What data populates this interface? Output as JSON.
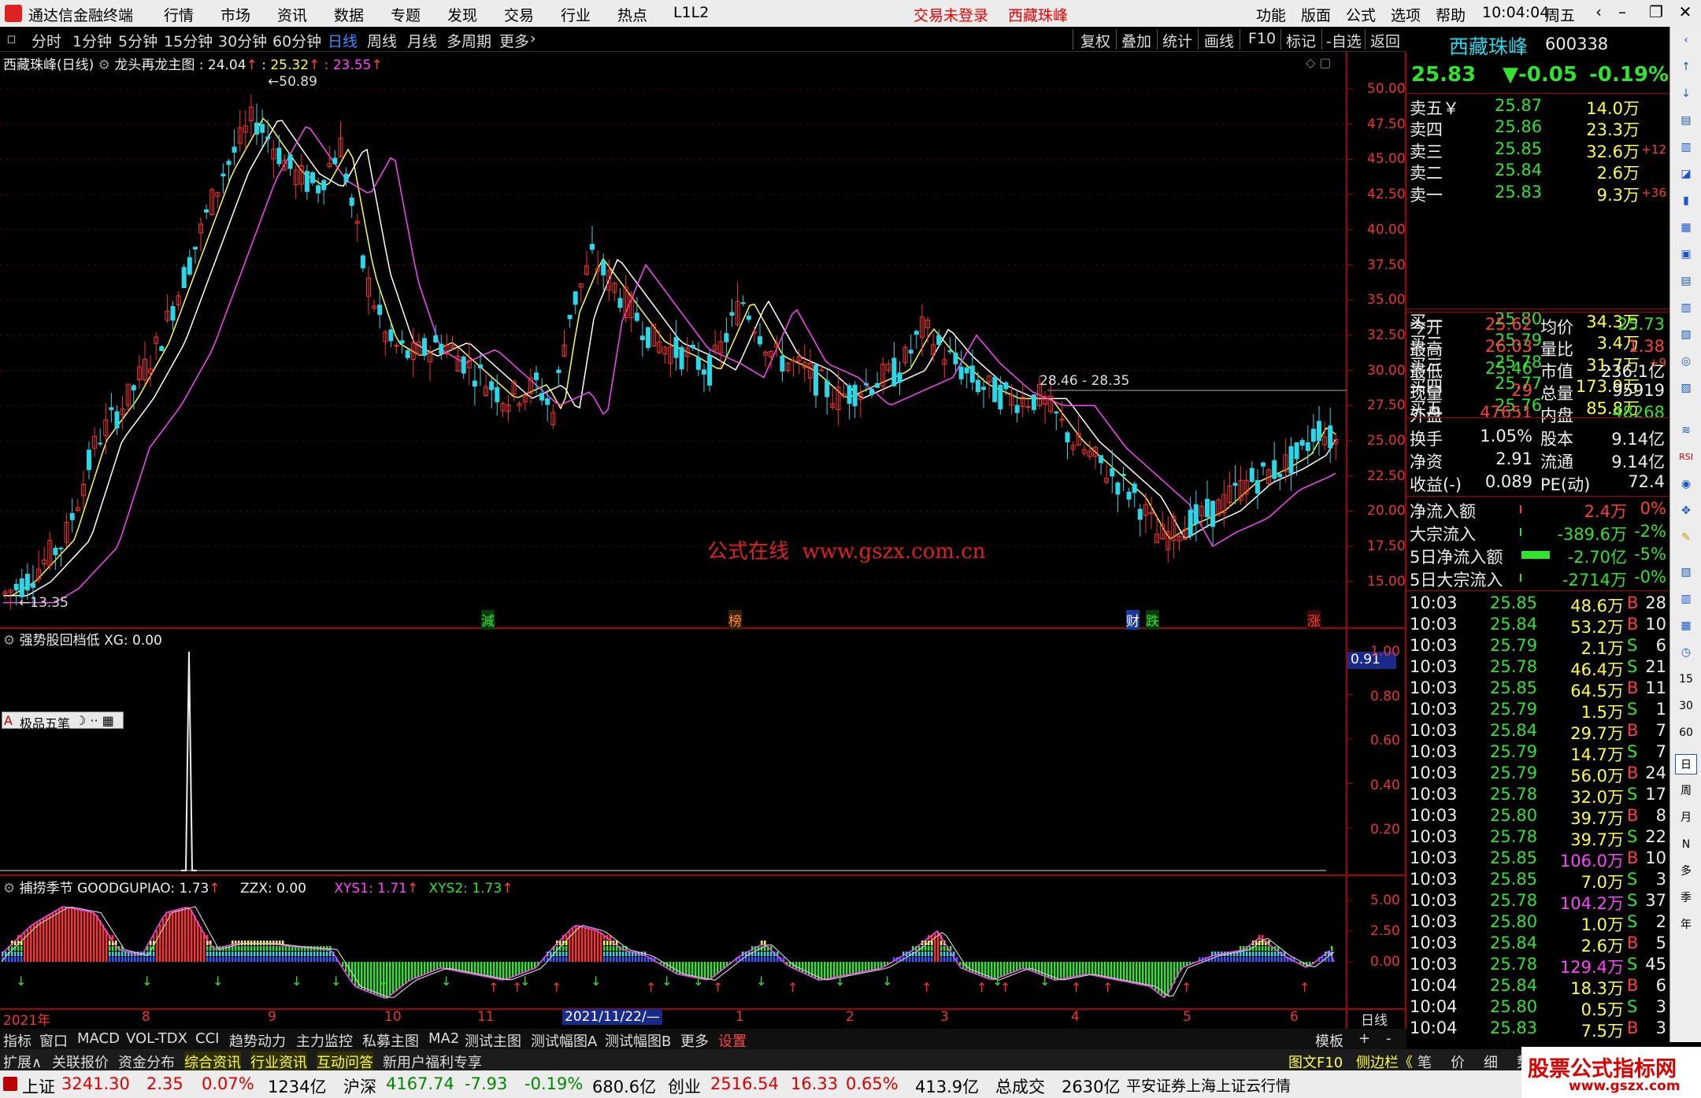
{
  "menubar": {
    "app_title": "通达信金融终端",
    "menus": [
      "行情",
      "市场",
      "资讯",
      "数据",
      "专题",
      "发现",
      "交易",
      "行业",
      "热点",
      "L1L2"
    ],
    "status": "交易未登录",
    "stock": "西藏珠峰",
    "right_menus": [
      "功能",
      "版面",
      "公式",
      "选项",
      "帮助"
    ],
    "time": "10:04:04",
    "weekday": "周五"
  },
  "periodbar": {
    "periods": [
      "分时",
      "1分钟",
      "5分钟",
      "15分钟",
      "30分钟",
      "60分钟",
      "日线",
      "周线",
      "月线",
      "多周期",
      "更多"
    ],
    "active": "日线",
    "tools": [
      "复权",
      "叠加",
      "统计",
      "画线",
      "F10",
      "标记",
      "-自选",
      "返回"
    ]
  },
  "main_chart": {
    "header_stock": "西藏珠峰(日线)",
    "header_formula": "龙头再龙主图",
    "ma1": "24.04",
    "ma2": "25.32",
    "ma3": "23.55",
    "high_label": "50.89",
    "low_label": "13.35",
    "line_label": "28.46 - 28.35",
    "watermark": "公式在线  www.gszx.com.cn",
    "y_ticks": [
      "50.00",
      "47.50",
      "45.00",
      "42.50",
      "40.00",
      "37.50",
      "35.00",
      "32.50",
      "30.00",
      "27.50",
      "25.00",
      "22.50",
      "20.00",
      "17.50",
      "15.00"
    ],
    "markers": [
      "減",
      "榜",
      "财",
      "跌",
      "涨"
    ]
  },
  "sub1": {
    "title": "强势股回档低",
    "value": "XG: 0.00",
    "widget": "极品五笔",
    "badge": "0.91",
    "y_ticks": [
      "1.00",
      "0.80",
      "0.60",
      "0.40",
      "0.20"
    ]
  },
  "sub2": {
    "title": "捕捞季节",
    "v1": "GOODGUPIAO: 1.73",
    "v2": "ZZX: 0.00",
    "v3": "XYS1: 1.71",
    "v4": "XYS2: 1.73",
    "y_ticks": [
      "5.00",
      "2.50",
      "0.00"
    ]
  },
  "xaxis": {
    "labels": [
      "2021年",
      "8",
      "9",
      "10",
      "11",
      "2021/11/22/—",
      "1",
      "2",
      "3",
      "4",
      "5",
      "6"
    ],
    "right_label": "日线"
  },
  "quote": {
    "name": "西藏珠峰",
    "code": "600338",
    "price": "25.83",
    "change": "▼-0.05",
    "pct": "-0.19%",
    "sells": [
      {
        "label": "卖五￥",
        "price": "25.87",
        "vol": "14.0万",
        "chg": ""
      },
      {
        "label": "卖四",
        "price": "25.86",
        "vol": "23.3万",
        "chg": ""
      },
      {
        "label": "卖三",
        "price": "25.85",
        "vol": "32.6万",
        "chg": "+12"
      },
      {
        "label": "卖二",
        "price": "25.84",
        "vol": "2.6万",
        "chg": ""
      },
      {
        "label": "卖一",
        "price": "25.83",
        "vol": "9.3万",
        "chg": "+36"
      }
    ],
    "buys": [
      {
        "label": "买一",
        "price": "25.80",
        "vol": "34.3万",
        "chg": ""
      },
      {
        "label": "买二",
        "price": "25.79",
        "vol": "3.4万",
        "chg": ""
      },
      {
        "label": "买三",
        "price": "25.78",
        "vol": "31.7万",
        "chg": "+9"
      },
      {
        "label": "买四",
        "price": "25.77",
        "vol": "173.9万",
        "chg": ""
      },
      {
        "label": "买五",
        "price": "25.76",
        "vol": "85.8万",
        "chg": ""
      }
    ],
    "stats": [
      {
        "l1": "今开",
        "v1": "25.62",
        "l2": "均价",
        "v2": "25.73"
      },
      {
        "l1": "最高",
        "v1": "26.03",
        "l2": "量比",
        "v2": "1.38"
      },
      {
        "l1": "最低",
        "v1": "25.46",
        "l2": "市值",
        "v2": "236.1亿"
      },
      {
        "l1": "现量",
        "v1": "29",
        "l2": "总量",
        "v2": "95919"
      },
      {
        "l1": "外盘",
        "v1": "47651",
        "l2": "内盘",
        "v2": "48268"
      }
    ],
    "stats2": [
      {
        "l1": "换手",
        "v1": "1.05%",
        "l2": "股本",
        "v2": "9.14亿"
      },
      {
        "l1": "净资",
        "v1": "2.91",
        "l2": "流通",
        "v2": "9.14亿"
      },
      {
        "l1": "收益(-)",
        "v1": "0.089",
        "l2": "PE(动)",
        "v2": "72.4"
      }
    ],
    "flows": [
      {
        "label": "净流入额",
        "value": "2.4万",
        "pct": "0%"
      },
      {
        "label": "大宗流入",
        "value": "-389.6万",
        "pct": "-2%"
      },
      {
        "label": "5日净流入额",
        "value": "-2.70亿",
        "pct": "-5%"
      },
      {
        "label": "5日大宗流入",
        "value": "-2714万",
        "pct": "-0%"
      }
    ],
    "ticks": [
      {
        "t": "10:03",
        "p": "25.85",
        "v": "48.6万",
        "bs": "B",
        "n": "28"
      },
      {
        "t": "10:03",
        "p": "25.84",
        "v": "53.2万",
        "bs": "B",
        "n": "10"
      },
      {
        "t": "10:03",
        "p": "25.79",
        "v": "2.1万",
        "bs": "S",
        "n": "6"
      },
      {
        "t": "10:03",
        "p": "25.78",
        "v": "46.4万",
        "bs": "S",
        "n": "21"
      },
      {
        "t": "10:03",
        "p": "25.85",
        "v": "64.5万",
        "bs": "B",
        "n": "11"
      },
      {
        "t": "10:03",
        "p": "25.79",
        "v": "1.5万",
        "bs": "S",
        "n": "1"
      },
      {
        "t": "10:03",
        "p": "25.84",
        "v": "29.7万",
        "bs": "B",
        "n": "7"
      },
      {
        "t": "10:03",
        "p": "25.79",
        "v": "14.7万",
        "bs": "S",
        "n": "7"
      },
      {
        "t": "10:03",
        "p": "25.79",
        "v": "56.0万",
        "bs": "B",
        "n": "24"
      },
      {
        "t": "10:03",
        "p": "25.78",
        "v": "32.0万",
        "bs": "S",
        "n": "17"
      },
      {
        "t": "10:03",
        "p": "25.80",
        "v": "39.7万",
        "bs": "B",
        "n": "8"
      },
      {
        "t": "10:03",
        "p": "25.78",
        "v": "39.7万",
        "bs": "S",
        "n": "22"
      },
      {
        "t": "10:03",
        "p": "25.85",
        "v": "106.0万",
        "bs": "B",
        "n": "10"
      },
      {
        "t": "10:03",
        "p": "25.85",
        "v": "7.0万",
        "bs": "S",
        "n": "3"
      },
      {
        "t": "10:03",
        "p": "25.78",
        "v": "104.2万",
        "bs": "S",
        "n": "37"
      },
      {
        "t": "10:03",
        "p": "25.80",
        "v": "1.0万",
        "bs": "S",
        "n": "2"
      },
      {
        "t": "10:03",
        "p": "25.84",
        "v": "2.6万",
        "bs": "B",
        "n": "5"
      },
      {
        "t": "10:03",
        "p": "25.78",
        "v": "129.4万",
        "bs": "S",
        "n": "45"
      },
      {
        "t": "10:04",
        "p": "25.84",
        "v": "18.3万",
        "bs": "B",
        "n": "6"
      },
      {
        "t": "10:04",
        "p": "25.80",
        "v": "0.5万",
        "bs": "S",
        "n": "3"
      },
      {
        "t": "10:04",
        "p": "25.83",
        "v": "7.5万",
        "bs": "B",
        "n": "3"
      }
    ]
  },
  "rightstrip": [
    "15",
    "30",
    "60",
    "日",
    "周",
    "月",
    "N",
    "多",
    "季",
    "年"
  ],
  "bottomtabs": [
    "指标",
    "窗口",
    "MACD",
    "VOL-TDX",
    "CCI",
    "趋势动力",
    "主力监控",
    "私募主图",
    "MA2",
    "测试主图",
    "测试幅图A",
    "测试幅图B",
    "更多",
    "设置",
    "模板",
    "+",
    "-"
  ],
  "bottomtabs2": [
    "扩展∧",
    "关联报价",
    "资金分布",
    "综合资讯",
    "行业资讯",
    "互动问答",
    "新用户福利专享"
  ],
  "bottomright": [
    "图文F10",
    "侧边栏《",
    "笔",
    "价",
    "细",
    "势"
  ],
  "indexbar": [
    {
      "name": "上证",
      "val": "3241.30",
      "chg": "2.35",
      "pct": "0.07%",
      "amt": "1234亿"
    },
    {
      "name": "沪深",
      "val": "4167.74",
      "chg": "-7.93",
      "pct": "-0.19%",
      "amt": "680.6亿"
    },
    {
      "name": "创业",
      "val": "2516.54",
      "chg": "16.33",
      "pct": "0.65%",
      "amt": "413.9亿"
    }
  ],
  "indexbar_extra": {
    "label": "总成交",
    "amt": "2630亿",
    "broker": "平安证券上海上证云行情"
  },
  "corner_watermark": "股票公式指标网",
  "corner_url": "www.gszx.com"
}
